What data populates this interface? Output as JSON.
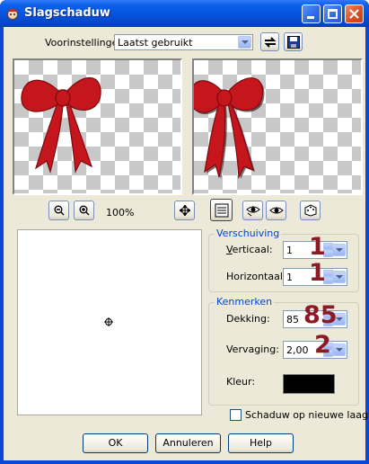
{
  "window": {
    "title": "Slagschaduw"
  },
  "presets": {
    "label": "Voorinstellingen:",
    "value": "Laatst gebruikt"
  },
  "zoom": {
    "level": "100%"
  },
  "offset": {
    "group_title": "Verschuiving",
    "vertical_label": "Verticaal:",
    "vertical_value": "1",
    "horizontal_label": "Horizontaal:",
    "horizontal_value": "1"
  },
  "properties": {
    "group_title": "Kenmerken",
    "opacity_label": "Dekking:",
    "opacity_value": "85",
    "blur_label": "Vervaging:",
    "blur_value": "2,00",
    "color_label": "Kleur:",
    "color": "#000000"
  },
  "annotations": {
    "vertical": "1",
    "horizontal": "1",
    "opacity": "85",
    "blur": "2"
  },
  "shadow_checkbox": {
    "label": "Schaduw op nieuwe laag",
    "checked": false
  },
  "buttons": {
    "ok": "OK",
    "cancel": "Annuleren",
    "help": "Help"
  },
  "colors": {
    "titlebar": "#0553dc",
    "dialog_bg": "#ece9d8",
    "group_title": "#0046d5",
    "annotation": "#8b1a24",
    "bow": "#c4161c"
  }
}
